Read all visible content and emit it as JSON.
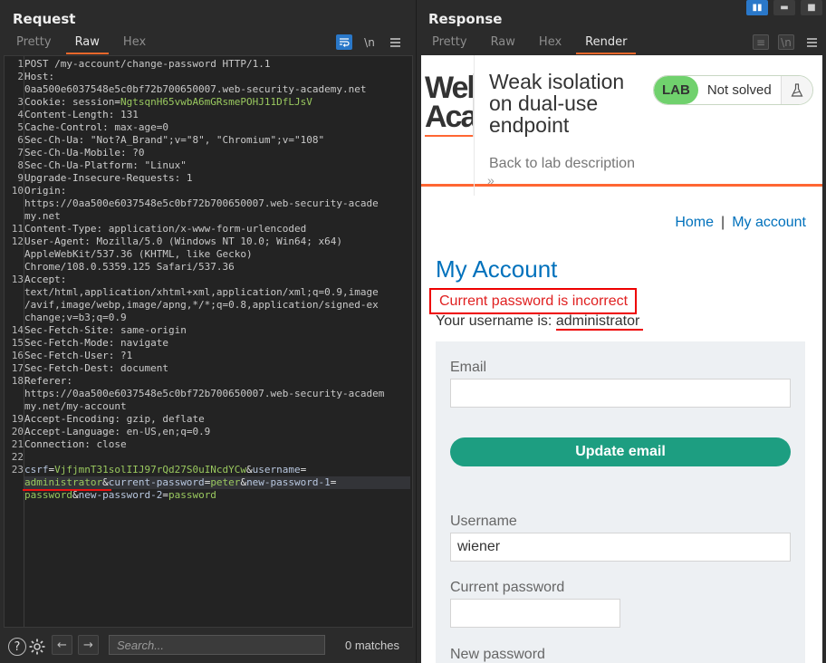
{
  "request": {
    "title": "Request",
    "tabs": [
      "Pretty",
      "Raw",
      "Hex"
    ],
    "active_tab": "Raw",
    "tool_icons": [
      "wrap-lines-icon",
      "newline-toggle-icon",
      "menu-icon"
    ],
    "newline_label": "\\n",
    "lines": [
      {
        "n": "1",
        "parts": [
          {
            "t": "POST /my-account/change-password HTTP/1.1",
            "c": "hv"
          }
        ]
      },
      {
        "n": "2",
        "parts": [
          {
            "t": "Host:",
            "c": "hk"
          }
        ]
      },
      {
        "n": "",
        "parts": [
          {
            "t": "0aa500e6037548e5c0bf72b700650007.web-security-academy.net",
            "c": "hv"
          }
        ]
      },
      {
        "n": "3",
        "parts": [
          {
            "t": "Cookie: ",
            "c": "hk"
          },
          {
            "t": "session",
            "c": "hv"
          },
          {
            "t": "=",
            "c": "amp"
          },
          {
            "t": "NgtsqnH65vwbA6mGRsmePOHJ11DfLJsV",
            "c": "pv"
          }
        ]
      },
      {
        "n": "4",
        "parts": [
          {
            "t": "Content-Length: ",
            "c": "hk"
          },
          {
            "t": "131",
            "c": "hv"
          }
        ]
      },
      {
        "n": "5",
        "parts": [
          {
            "t": "Cache-Control: ",
            "c": "hk"
          },
          {
            "t": "max-age=0",
            "c": "hv"
          }
        ]
      },
      {
        "n": "6",
        "parts": [
          {
            "t": "Sec-Ch-Ua: ",
            "c": "hk"
          },
          {
            "t": "\"Not?A_Brand\";v=\"8\", \"Chromium\";v=\"108\"",
            "c": "hv"
          }
        ]
      },
      {
        "n": "7",
        "parts": [
          {
            "t": "Sec-Ch-Ua-Mobile: ",
            "c": "hk"
          },
          {
            "t": "?0",
            "c": "hv"
          }
        ]
      },
      {
        "n": "8",
        "parts": [
          {
            "t": "Sec-Ch-Ua-Platform: ",
            "c": "hk"
          },
          {
            "t": "\"Linux\"",
            "c": "hv"
          }
        ]
      },
      {
        "n": "9",
        "parts": [
          {
            "t": "Upgrade-Insecure-Requests: ",
            "c": "hk"
          },
          {
            "t": "1",
            "c": "hv"
          }
        ]
      },
      {
        "n": "10",
        "parts": [
          {
            "t": "Origin:",
            "c": "hk"
          }
        ]
      },
      {
        "n": "",
        "parts": [
          {
            "t": "https://0aa500e6037548e5c0bf72b700650007.web-security-acade",
            "c": "hv"
          }
        ]
      },
      {
        "n": "",
        "parts": [
          {
            "t": "my.net",
            "c": "hv"
          }
        ]
      },
      {
        "n": "11",
        "parts": [
          {
            "t": "Content-Type: ",
            "c": "hk"
          },
          {
            "t": "application/x-www-form-urlencoded",
            "c": "hv"
          }
        ]
      },
      {
        "n": "12",
        "parts": [
          {
            "t": "User-Agent: ",
            "c": "hk"
          },
          {
            "t": "Mozilla/5.0 (Windows NT 10.0; Win64; x64)",
            "c": "hv"
          }
        ]
      },
      {
        "n": "",
        "parts": [
          {
            "t": "AppleWebKit/537.36 (KHTML, like Gecko)",
            "c": "hv"
          }
        ]
      },
      {
        "n": "",
        "parts": [
          {
            "t": "Chrome/108.0.5359.125 Safari/537.36",
            "c": "hv"
          }
        ]
      },
      {
        "n": "13",
        "parts": [
          {
            "t": "Accept:",
            "c": "hk"
          }
        ]
      },
      {
        "n": "",
        "parts": [
          {
            "t": "text/html,application/xhtml+xml,application/xml;q=0.9,image",
            "c": "hv"
          }
        ]
      },
      {
        "n": "",
        "parts": [
          {
            "t": "/avif,image/webp,image/apng,*/*;q=0.8,application/signed-ex",
            "c": "hv"
          }
        ]
      },
      {
        "n": "",
        "parts": [
          {
            "t": "change;v=b3;q=0.9",
            "c": "hv"
          }
        ]
      },
      {
        "n": "14",
        "parts": [
          {
            "t": "Sec-Fetch-Site: ",
            "c": "hk"
          },
          {
            "t": "same-origin",
            "c": "hv"
          }
        ]
      },
      {
        "n": "15",
        "parts": [
          {
            "t": "Sec-Fetch-Mode: ",
            "c": "hk"
          },
          {
            "t": "navigate",
            "c": "hv"
          }
        ]
      },
      {
        "n": "16",
        "parts": [
          {
            "t": "Sec-Fetch-User: ",
            "c": "hk"
          },
          {
            "t": "?1",
            "c": "hv"
          }
        ]
      },
      {
        "n": "17",
        "parts": [
          {
            "t": "Sec-Fetch-Dest: ",
            "c": "hk"
          },
          {
            "t": "document",
            "c": "hv"
          }
        ]
      },
      {
        "n": "18",
        "parts": [
          {
            "t": "Referer:",
            "c": "hk"
          }
        ]
      },
      {
        "n": "",
        "parts": [
          {
            "t": "https://0aa500e6037548e5c0bf72b700650007.web-security-academ",
            "c": "hv"
          }
        ]
      },
      {
        "n": "",
        "parts": [
          {
            "t": "my.net/my-account",
            "c": "hv"
          }
        ]
      },
      {
        "n": "19",
        "parts": [
          {
            "t": "Accept-Encoding: ",
            "c": "hk"
          },
          {
            "t": "gzip, deflate",
            "c": "hv"
          }
        ]
      },
      {
        "n": "20",
        "parts": [
          {
            "t": "Accept-Language: ",
            "c": "hk"
          },
          {
            "t": "en-US,en;q=0.9",
            "c": "hv"
          }
        ]
      },
      {
        "n": "21",
        "parts": [
          {
            "t": "Connection: ",
            "c": "hk"
          },
          {
            "t": "close",
            "c": "hv"
          }
        ]
      },
      {
        "n": "22",
        "parts": []
      },
      {
        "n": "23",
        "parts": [
          {
            "t": "csrf",
            "c": "pk"
          },
          {
            "t": "=",
            "c": "amp"
          },
          {
            "t": "VjfjmnT31solIIJ97rQd27S0uINcdYCw",
            "c": "pv"
          },
          {
            "t": "&",
            "c": "amp"
          },
          {
            "t": "username",
            "c": "pk"
          },
          {
            "t": "=",
            "c": "amp"
          }
        ]
      },
      {
        "n": "",
        "cursor": true,
        "parts": [
          {
            "t": "administrator",
            "c": "pv"
          },
          {
            "t": "&",
            "c": "amp"
          },
          {
            "t": "current-password",
            "c": "pk"
          },
          {
            "t": "=",
            "c": "amp"
          },
          {
            "t": "peter",
            "c": "pv"
          },
          {
            "t": "&",
            "c": "amp"
          },
          {
            "t": "new-password-1",
            "c": "pk"
          },
          {
            "t": "=",
            "c": "amp"
          }
        ]
      },
      {
        "n": "",
        "parts": [
          {
            "t": "password",
            "c": "pv"
          },
          {
            "t": "&",
            "c": "amp"
          },
          {
            "t": "new-password-2",
            "c": "pk"
          },
          {
            "t": "=",
            "c": "amp"
          },
          {
            "t": "password",
            "c": "pv"
          }
        ]
      }
    ],
    "search_placeholder": "Search...",
    "matches": "0 matches"
  },
  "response": {
    "title": "Response",
    "tabs": [
      "Pretty",
      "Raw",
      "Hex",
      "Render"
    ],
    "active_tab": "Render",
    "render": {
      "logo_text": "Web Academy",
      "lab_title": "Weak isolation on dual-use endpoint",
      "back_link": "Back to lab description",
      "back_chevrons": "»",
      "lab_badge": "LAB",
      "lab_status": "Not solved",
      "nav": {
        "home": "Home",
        "separator": "|",
        "my_account": "My account"
      },
      "heading": "My Account",
      "error": "Current password is incorrect",
      "username_prefix": "Your username is: ",
      "username_value": "administrator",
      "email_label": "Email",
      "email_value": "",
      "update_email_button": "Update email",
      "username_label": "Username",
      "username_field_value": "wiener",
      "current_password_label": "Current password",
      "current_password_value": "",
      "new_password_label": "New password"
    }
  },
  "colors": {
    "accent_orange": "#e8672b",
    "toggle_blue": "#2a78c9",
    "link_blue": "#0071bc",
    "update_button": "#1d9e81",
    "lab_green": "#70d16d",
    "error_red": "#e02020",
    "param_value_green": "#9ac95f"
  }
}
